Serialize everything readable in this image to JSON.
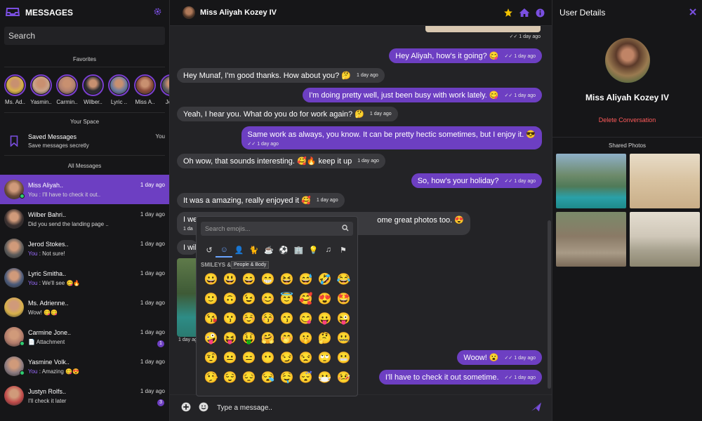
{
  "colors": {
    "accent": "#6d3fc2",
    "panel": "#161618",
    "chat_bg": "#232326",
    "incoming": "#3a3a3e",
    "danger": "#ff5a5a",
    "star": "#f2c200",
    "online": "#2ecc71"
  },
  "sidebar": {
    "title": "MESSAGES",
    "search_placeholder": "Search",
    "favorites_label": "Favorites",
    "favorites": [
      {
        "name": "Ms. Ad.."
      },
      {
        "name": "Yasmin.."
      },
      {
        "name": "Carmin.."
      },
      {
        "name": "Wilber.."
      },
      {
        "name": "Lyric .."
      },
      {
        "name": "Miss A.."
      },
      {
        "name": "Jero"
      }
    ],
    "your_space_label": "Your Space",
    "saved": {
      "title": "Saved Messages",
      "subtitle": "Save messages secretly",
      "tag": "You"
    },
    "all_messages_label": "All Messages",
    "conversations": [
      {
        "name": "Miss Aliyah..",
        "you": "",
        "preview": "You : I'll have to check it out..",
        "time": "1 day ago",
        "badge": ""
      },
      {
        "name": "Wilber Bahri..",
        "you": "",
        "preview": "Did you send the landing page ..",
        "time": "1 day ago",
        "badge": ""
      },
      {
        "name": "Jerod Stokes..",
        "you": "You",
        "preview": " : Not sure!",
        "time": "1 day ago",
        "badge": ""
      },
      {
        "name": "Lyric Smitha..",
        "you": "You",
        "preview": " : We'll see 😋🔥",
        "time": "1 day ago",
        "badge": ""
      },
      {
        "name": "Ms. Adrienne..",
        "you": "",
        "preview": "Wow! 😋😋",
        "time": "1 day ago",
        "badge": ""
      },
      {
        "name": "Carmine Jone..",
        "you": "",
        "preview": "📄 Attachment",
        "time": "1 day ago",
        "badge": "1"
      },
      {
        "name": "Yasmine Volk..",
        "you": "You",
        "preview": " : Amazing 😋😍",
        "time": "1 day ago",
        "badge": ""
      },
      {
        "name": "Justyn Rolfs..",
        "you": "",
        "preview": "I'll check it later",
        "time": "1 day ago",
        "badge": "3"
      }
    ]
  },
  "chat": {
    "contact_name": "Miss Aliyah Kozey IV",
    "top_time": "1 day ago",
    "messages": [
      {
        "dir": "out",
        "text": "Hey Aliyah, how's it going? 😋",
        "time": "1 day ago"
      },
      {
        "dir": "in",
        "text": "Hey Munaf, I'm good thanks. How about you? 🤔",
        "time": "1 day ago"
      },
      {
        "dir": "out",
        "text": "I'm doing pretty well, just been busy with work lately. 😋",
        "time": "1 day ago"
      },
      {
        "dir": "in",
        "text": "Yeah, I hear you. What do you do for work again? 🤔",
        "time": "1 day ago"
      },
      {
        "dir": "out",
        "text": "Same work as always, you know. It can be pretty hectic sometimes, but I enjoy it. 😎",
        "time": "1 day ago"
      },
      {
        "dir": "in",
        "text": "Oh wow, that sounds interesting. 🥰🔥 keep it up",
        "time": "1 day ago"
      },
      {
        "dir": "out",
        "text": "So, how's your holiday?",
        "time": "1 day ago"
      },
      {
        "dir": "in",
        "text": "It was a amazing, really enjoyed it 🥰",
        "time": "1 day ago"
      },
      {
        "dir": "in",
        "text": "I we",
        "time": "1 da",
        "tail": "ome great photos too. 😍"
      },
      {
        "dir": "in",
        "text": "I wil",
        "time": ""
      },
      {
        "dir": "in",
        "text": "",
        "time": "1 day ago"
      },
      {
        "dir": "out",
        "text": "Woow! 😮",
        "time": "1 day ago"
      },
      {
        "dir": "out",
        "text": "I'll have to check it out sometime.",
        "time": "1 day ago"
      }
    ],
    "composer_placeholder": "Type a message.."
  },
  "emoji_picker": {
    "search_placeholder": "Search emojis...",
    "category_icons": [
      "recent-icon",
      "smiley-icon",
      "person-icon",
      "animal-icon",
      "food-icon",
      "activity-icon",
      "building-icon",
      "object-icon",
      "music-icon",
      "flag-icon"
    ],
    "category_glyphs": [
      "↺",
      "☺",
      "👤",
      "🐈",
      "☕",
      "⚽",
      "🏢",
      "💡",
      "♫",
      "⚑"
    ],
    "group_label": "SMILEYS &",
    "tooltip": "People & Body",
    "emojis": [
      "😀",
      "😃",
      "😄",
      "😁",
      "😆",
      "😅",
      "🤣",
      "😂",
      "🙂",
      "🙃",
      "😉",
      "😊",
      "😇",
      "🥰",
      "😍",
      "🤩",
      "😘",
      "😗",
      "☺️",
      "😚",
      "😙",
      "😋",
      "😛",
      "😜",
      "🤪",
      "😝",
      "🤑",
      "🤗",
      "🤭",
      "🤫",
      "🤔",
      "🤐",
      "🤨",
      "😐",
      "😑",
      "😶",
      "😏",
      "😒",
      "🙄",
      "😬",
      "🤥",
      "😌",
      "😔",
      "😪",
      "🤤",
      "😴",
      "😷",
      "🤒"
    ]
  },
  "details": {
    "title": "User Details",
    "name": "Miss Aliyah Kozey IV",
    "delete_label": "Delete Conversation",
    "shared_label": "Shared Photos"
  }
}
